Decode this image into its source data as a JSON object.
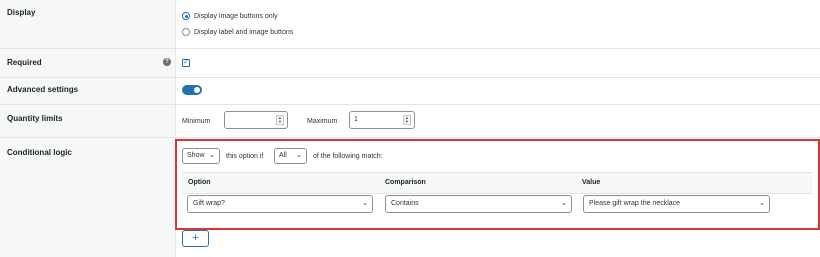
{
  "rows": {
    "display": {
      "label": "Display",
      "options": [
        "Display image buttons only",
        "Display label and image buttons"
      ],
      "selected_index": 0
    },
    "required": {
      "label": "Required",
      "help_icon": "?",
      "checked": true,
      "check_glyph": "✓"
    },
    "advanced": {
      "label": "Advanced settings",
      "enabled": true
    },
    "quantity": {
      "label": "Quantity limits",
      "min_label": "Minimum",
      "min_value": "",
      "max_label": "Maximum",
      "max_value": "1"
    },
    "conditional": {
      "label": "Conditional logic",
      "action": "Show",
      "text_1": "this option if",
      "match": "All",
      "text_2": "of the following match:",
      "columns": [
        "Option",
        "Comparison",
        "Value"
      ],
      "rule": {
        "option": "Gift wrap?",
        "comparison": "Contains",
        "value": "Please gift wrap the necklace"
      },
      "add_label": "+"
    }
  },
  "colors": {
    "accent": "#2271b1",
    "highlight_border": "#d63638",
    "label_bg": "#f6f7f7"
  }
}
